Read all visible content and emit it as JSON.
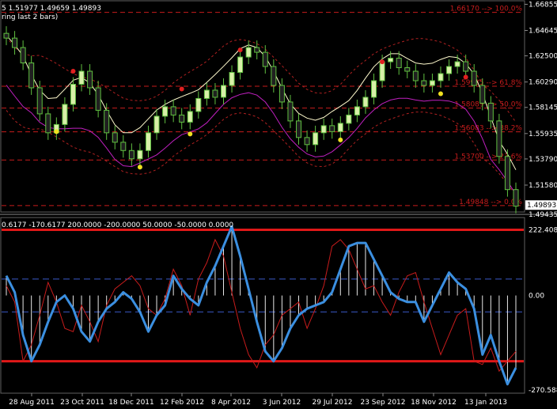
{
  "main_header": {
    "ohlc": "5 1.51977 1.49659 1.49893",
    "note": "ring last 2 bars)"
  },
  "price_axis": {
    "labels": [
      "1.66855",
      "1.64645",
      "1.62500",
      "1.60290",
      "1.58145",
      "1.55935",
      "1.53790",
      "1.51580"
    ],
    "values": [
      1.66855,
      1.64645,
      1.625,
      1.6029,
      1.58145,
      1.55935,
      1.5379,
      1.5158
    ],
    "current_price": "1.49893",
    "bottom_label": "1.49435",
    "range": [
      1.4944,
      1.6695
    ]
  },
  "fibo_levels": [
    {
      "label": "1.66170 --> 100.0%",
      "value": 1.6617
    },
    {
      "label": "1.59935 --> 61.8%",
      "value": 1.59935
    },
    {
      "label": "1.58089 --> 50.0%",
      "value": 1.58089
    },
    {
      "label": "1.56083 --> 38.2%",
      "value": 1.56083
    },
    {
      "label": "1.53700 --> 23.6%",
      "value": 1.537
    },
    {
      "label": "1.49848 --> 0.0%",
      "value": 1.49848
    }
  ],
  "indicator_header": "0.6177 -170.6177 200.0000 -200.0000 50.0000 -50.0000 0.0000",
  "indicator_axis": {
    "top_label": "222.4086",
    "zero_label": "0.00",
    "bottom_label": "-270.588",
    "range": [
      -290,
      230
    ],
    "upper_level": 200,
    "lower_level": -200,
    "upper_dash": 50,
    "lower_dash": -50
  },
  "time_axis": [
    "28 Aug 2011",
    "23 Oct 2011",
    "18 Dec 2011",
    "12 Feb 2012",
    "8 Apr 2012",
    "3 Jun 2012",
    "29 Jul 2012",
    "23 Sep 2012",
    "18 Nov 2012",
    "13 Jan 2013"
  ],
  "colors": {
    "background": "#000000",
    "bull_candle": "#d8f0a8",
    "bear_candle": "#202020",
    "wick": "#60c040",
    "fibo": "#c81c1c",
    "upper_ma": "#fffacd",
    "magenta_ma": "#c020c0",
    "band": "#b02020",
    "cci_line": "#3b8fe0",
    "cci_red": "#c81c1c",
    "histogram": "#e8e8e8",
    "dash": "#3a5ac8",
    "grid": "#ffffff"
  },
  "chart_data": {
    "type": "candlestick-with-oscillator",
    "title": "",
    "close": [
      1.64,
      1.632,
      1.619,
      1.598,
      1.576,
      1.56,
      1.567,
      1.584,
      1.601,
      1.612,
      1.598,
      1.579,
      1.56,
      1.552,
      1.545,
      1.538,
      1.545,
      1.56,
      1.574,
      1.582,
      1.575,
      1.569,
      1.578,
      1.589,
      1.596,
      1.59,
      1.6,
      1.611,
      1.624,
      1.632,
      1.628,
      1.616,
      1.6,
      1.586,
      1.57,
      1.556,
      1.55,
      1.56,
      1.566,
      1.561,
      1.568,
      1.575,
      1.582,
      1.59,
      1.604,
      1.62,
      1.623,
      1.615,
      1.612,
      1.604,
      1.6,
      1.604,
      1.61,
      1.616,
      1.62,
      1.612,
      1.6,
      1.585,
      1.57,
      1.54,
      1.512,
      1.498
    ],
    "highs_markers": [
      1.612,
      1.597,
      1.63,
      1.62,
      1.607
    ],
    "lows_markers": [
      1.561,
      1.531,
      1.559,
      1.554,
      1.593
    ],
    "cci": [
      60,
      10,
      -120,
      -200,
      -150,
      -80,
      -20,
      0,
      -40,
      -110,
      -140,
      -80,
      -40,
      -20,
      10,
      -10,
      -50,
      -110,
      -60,
      -30,
      60,
      20,
      -10,
      -30,
      40,
      90,
      150,
      210,
      120,
      20,
      -80,
      -170,
      -200,
      -160,
      -100,
      -60,
      -40,
      -30,
      -20,
      10,
      80,
      150,
      160,
      160,
      110,
      60,
      10,
      -10,
      -20,
      -20,
      -80,
      -30,
      20,
      70,
      40,
      20,
      -40,
      -180,
      -120,
      -200,
      -270,
      -220
    ],
    "cci_red": [
      30,
      -20,
      -200,
      -150,
      -60,
      40,
      -20,
      -100,
      -110,
      -30,
      -80,
      -140,
      -30,
      20,
      40,
      60,
      30,
      -40,
      -60,
      -10,
      80,
      30,
      -60,
      50,
      100,
      170,
      120,
      10,
      -100,
      -180,
      -220,
      -150,
      -120,
      -60,
      -40,
      -20,
      -100,
      -40,
      30,
      150,
      170,
      140,
      80,
      20,
      30,
      -20,
      -60,
      10,
      60,
      70,
      -20,
      -100,
      -180,
      -120,
      -60,
      -40,
      -200,
      -210,
      -160,
      -230,
      -200,
      -170
    ]
  }
}
